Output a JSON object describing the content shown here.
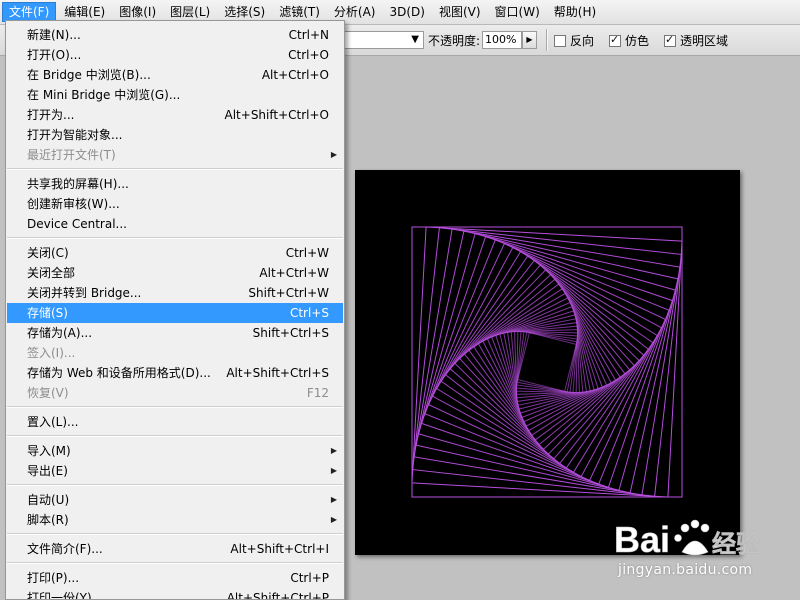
{
  "menubar": {
    "items": [
      {
        "label": "文件(F)",
        "active": true
      },
      {
        "label": "编辑(E)"
      },
      {
        "label": "图像(I)"
      },
      {
        "label": "图层(L)"
      },
      {
        "label": "选择(S)"
      },
      {
        "label": "滤镜(T)"
      },
      {
        "label": "分析(A)"
      },
      {
        "label": "3D(D)"
      },
      {
        "label": "视图(V)"
      },
      {
        "label": "窗口(W)"
      },
      {
        "label": "帮助(H)"
      }
    ]
  },
  "options_bar": {
    "opacity_label": "不透明度:",
    "opacity_value": "100%",
    "reverse_label": "反向",
    "reverse_checked": false,
    "dither_label": "仿色",
    "dither_checked": true,
    "transparency_label": "透明区域",
    "transparency_checked": true
  },
  "file_menu": {
    "items": [
      {
        "label": "新建(N)...",
        "shortcut": "Ctrl+N"
      },
      {
        "label": "打开(O)...",
        "shortcut": "Ctrl+O"
      },
      {
        "label": "在 Bridge 中浏览(B)...",
        "shortcut": "Alt+Ctrl+O"
      },
      {
        "label": "在 Mini Bridge 中浏览(G)...",
        "shortcut": ""
      },
      {
        "label": "打开为...",
        "shortcut": "Alt+Shift+Ctrl+O"
      },
      {
        "label": "打开为智能对象...",
        "shortcut": ""
      },
      {
        "label": "最近打开文件(T)",
        "shortcut": "",
        "submenu": true,
        "disabled": true
      },
      {
        "separator": true
      },
      {
        "label": "共享我的屏幕(H)...",
        "shortcut": ""
      },
      {
        "label": "创建新审核(W)...",
        "shortcut": ""
      },
      {
        "label": "Device Central...",
        "shortcut": ""
      },
      {
        "separator": true
      },
      {
        "label": "关闭(C)",
        "shortcut": "Ctrl+W"
      },
      {
        "label": "关闭全部",
        "shortcut": "Alt+Ctrl+W"
      },
      {
        "label": "关闭并转到 Bridge...",
        "shortcut": "Shift+Ctrl+W"
      },
      {
        "label": "存储(S)",
        "shortcut": "Ctrl+S",
        "highlighted": true
      },
      {
        "label": "存储为(A)...",
        "shortcut": "Shift+Ctrl+S"
      },
      {
        "label": "签入(I)...",
        "shortcut": "",
        "disabled": true
      },
      {
        "label": "存储为 Web 和设备所用格式(D)...",
        "shortcut": "Alt+Shift+Ctrl+S"
      },
      {
        "label": "恢复(V)",
        "shortcut": "F12",
        "disabled": true
      },
      {
        "separator": true
      },
      {
        "label": "置入(L)...",
        "shortcut": ""
      },
      {
        "separator": true
      },
      {
        "label": "导入(M)",
        "shortcut": "",
        "submenu": true
      },
      {
        "label": "导出(E)",
        "shortcut": "",
        "submenu": true
      },
      {
        "separator": true
      },
      {
        "label": "自动(U)",
        "shortcut": "",
        "submenu": true
      },
      {
        "label": "脚本(R)",
        "shortcut": "",
        "submenu": true
      },
      {
        "separator": true
      },
      {
        "label": "文件简介(F)...",
        "shortcut": "Alt+Shift+Ctrl+I"
      },
      {
        "separator": true
      },
      {
        "label": "打印(P)...",
        "shortcut": "Ctrl+P"
      },
      {
        "label": "打印一份(Y)",
        "shortcut": "Alt+Shift+Ctrl+P"
      }
    ]
  },
  "canvas": {
    "background": "#000000",
    "stroke_color": "#b84fe0",
    "shape": "rotating-squares-spiral"
  },
  "watermark": {
    "brand": "Bai",
    "brand_tail": "经验",
    "url": "jingyan.baidu.com"
  },
  "colors": {
    "accent": "#3399ff",
    "menu_bg": "#f0f0f0",
    "workspace": "#c1c1c1"
  }
}
